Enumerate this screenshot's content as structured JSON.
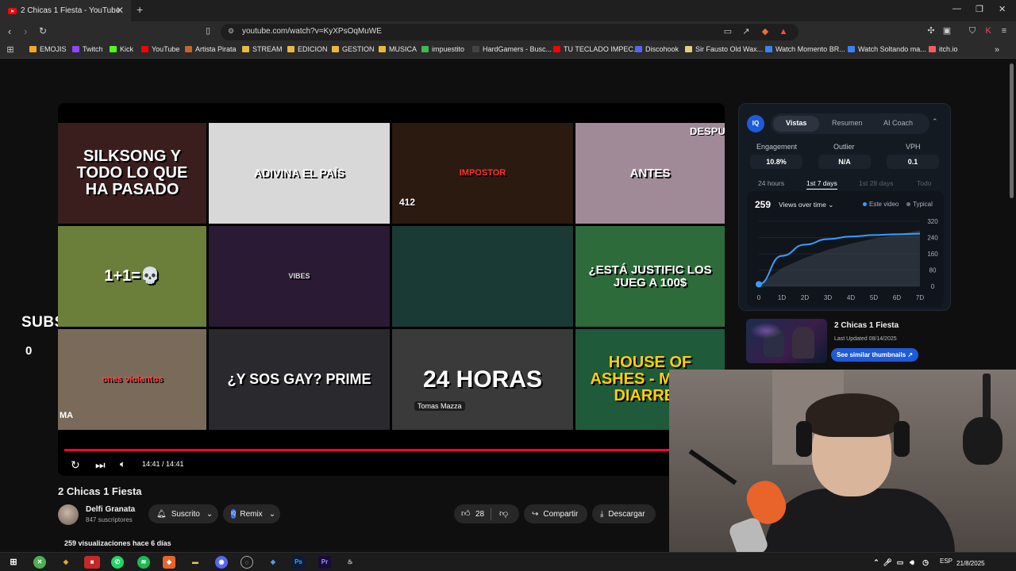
{
  "browser": {
    "tab_title": "2 Chicas 1 Fiesta - YouTube",
    "tab_close": "✕",
    "new_tab": "+",
    "url": "youtube.com/watch?v=KyXPsOqMuWE",
    "bookmarks": [
      {
        "label": "EMOJIS",
        "color": "#f5a623"
      },
      {
        "label": "Twitch",
        "color": "#9146ff"
      },
      {
        "label": "Kick",
        "color": "#53fc18"
      },
      {
        "label": "YouTube",
        "color": "#ff0000"
      },
      {
        "label": "Artista Pirata",
        "color": "#c8642a"
      },
      {
        "label": "STREAM",
        "color": "#e8b93d"
      },
      {
        "label": "EDICION",
        "color": "#e8b93d"
      },
      {
        "label": "GESTION",
        "color": "#e8b93d"
      },
      {
        "label": "MUSICA",
        "color": "#e8b93d"
      },
      {
        "label": "impuestito",
        "color": "#3fb950"
      },
      {
        "label": "HardGamers - Busc...",
        "color": "#444444"
      },
      {
        "label": "TU TECLADO IMPEC...",
        "color": "#ff0000"
      },
      {
        "label": "Discohook",
        "color": "#5865f2"
      },
      {
        "label": "Sir Fausto Old Wax...",
        "color": "#e0d080"
      },
      {
        "label": "Watch Momento BR...",
        "color": "#3b82f6"
      },
      {
        "label": "Watch Soltando ma...",
        "color": "#3b82f6"
      },
      {
        "label": "itch.io",
        "color": "#fa5c5c"
      }
    ]
  },
  "overlay": {
    "subs_label": "SUBS",
    "subs_count": "0"
  },
  "player": {
    "time": "14:41 / 14:41",
    "thumbnails": [
      {
        "text": "SILKSONG Y TODO LO QUE HA PASADO",
        "bg": "#3a1e1e"
      },
      {
        "text": "ADIVINA EL PAÍS",
        "bg": "#d8d8d8"
      },
      {
        "text": "IMPOSTOR",
        "bg": "#2b1a10"
      },
      {
        "text": "ANTES",
        "bg": "#a08a98"
      },
      {
        "text": "1+1=💀",
        "bg": "#6b7f3a"
      },
      {
        "text": "VIBES",
        "bg": "#2a1a33"
      },
      {
        "text": "",
        "bg": "#1a3a36"
      },
      {
        "text": "¿ESTÁ JUSTIFIC LOS JUEG A 100$",
        "bg": "#2e6b3a"
      },
      {
        "text": "ones violentos",
        "bg": "#7a6a5a"
      },
      {
        "text": "¿Y SOS GAY? PRIME",
        "bg": "#2a2a2e"
      },
      {
        "text": "24 HORAS",
        "bg": "#3a3a3a"
      },
      {
        "text": "HOUSE OF ASHES - ME DA DIARREA",
        "bg": "#1f5a3a"
      }
    ],
    "thumb_extra": {
      "count": "412",
      "name": "Tomas Mazza",
      "after": "DESPU",
      "ma": "MA"
    }
  },
  "video": {
    "title": "2 Chicas 1 Fiesta",
    "channel": "Delfi Granata",
    "channel_subs": "847 suscriptores",
    "subscribed_label": "Suscrito",
    "remix_label": "Remix",
    "likes": "28",
    "share_label": "Compartir",
    "download_label": "Descargar",
    "views_line": "259 visualizaciones  hace 6 días"
  },
  "vidiq": {
    "logo": "IQ",
    "tabs": [
      "Vistas",
      "Resumen",
      "AI Coach"
    ],
    "metrics": [
      {
        "label": "Engagement",
        "value": "10.8%"
      },
      {
        "label": "Outlier",
        "value": "N/A"
      },
      {
        "label": "VPH",
        "value": "0.1"
      }
    ],
    "ranges": [
      "24 hours",
      "1st 7 days",
      "1st 28 days",
      "Todo"
    ],
    "views": "259",
    "views_over_time": "Views over time ⌄",
    "legend_this": "Este video",
    "legend_typical": "Typical",
    "colors": {
      "accent": "#3b9cff",
      "typical": "#6b7480"
    }
  },
  "chart_data": {
    "type": "area",
    "categories": [
      "0",
      "1D",
      "2D",
      "3D",
      "4D",
      "5D",
      "6D",
      "7D"
    ],
    "y_ticks": [
      "0",
      "80",
      "160",
      "240",
      "320"
    ],
    "ylim": [
      0,
      320
    ],
    "series": [
      {
        "name": "Este video",
        "values": [
          10,
          150,
          205,
          232,
          245,
          252,
          256,
          259
        ]
      },
      {
        "name": "Typical",
        "values": [
          5,
          90,
          140,
          180,
          210,
          235,
          255,
          275
        ]
      }
    ]
  },
  "related": {
    "title": "2 Chicas 1 Fiesta",
    "date": "Last Updated 08/14/2025",
    "button": "See similar thumbnails ↗"
  },
  "taskbar": {
    "lang": "ESP",
    "date": "21/8/2025"
  }
}
